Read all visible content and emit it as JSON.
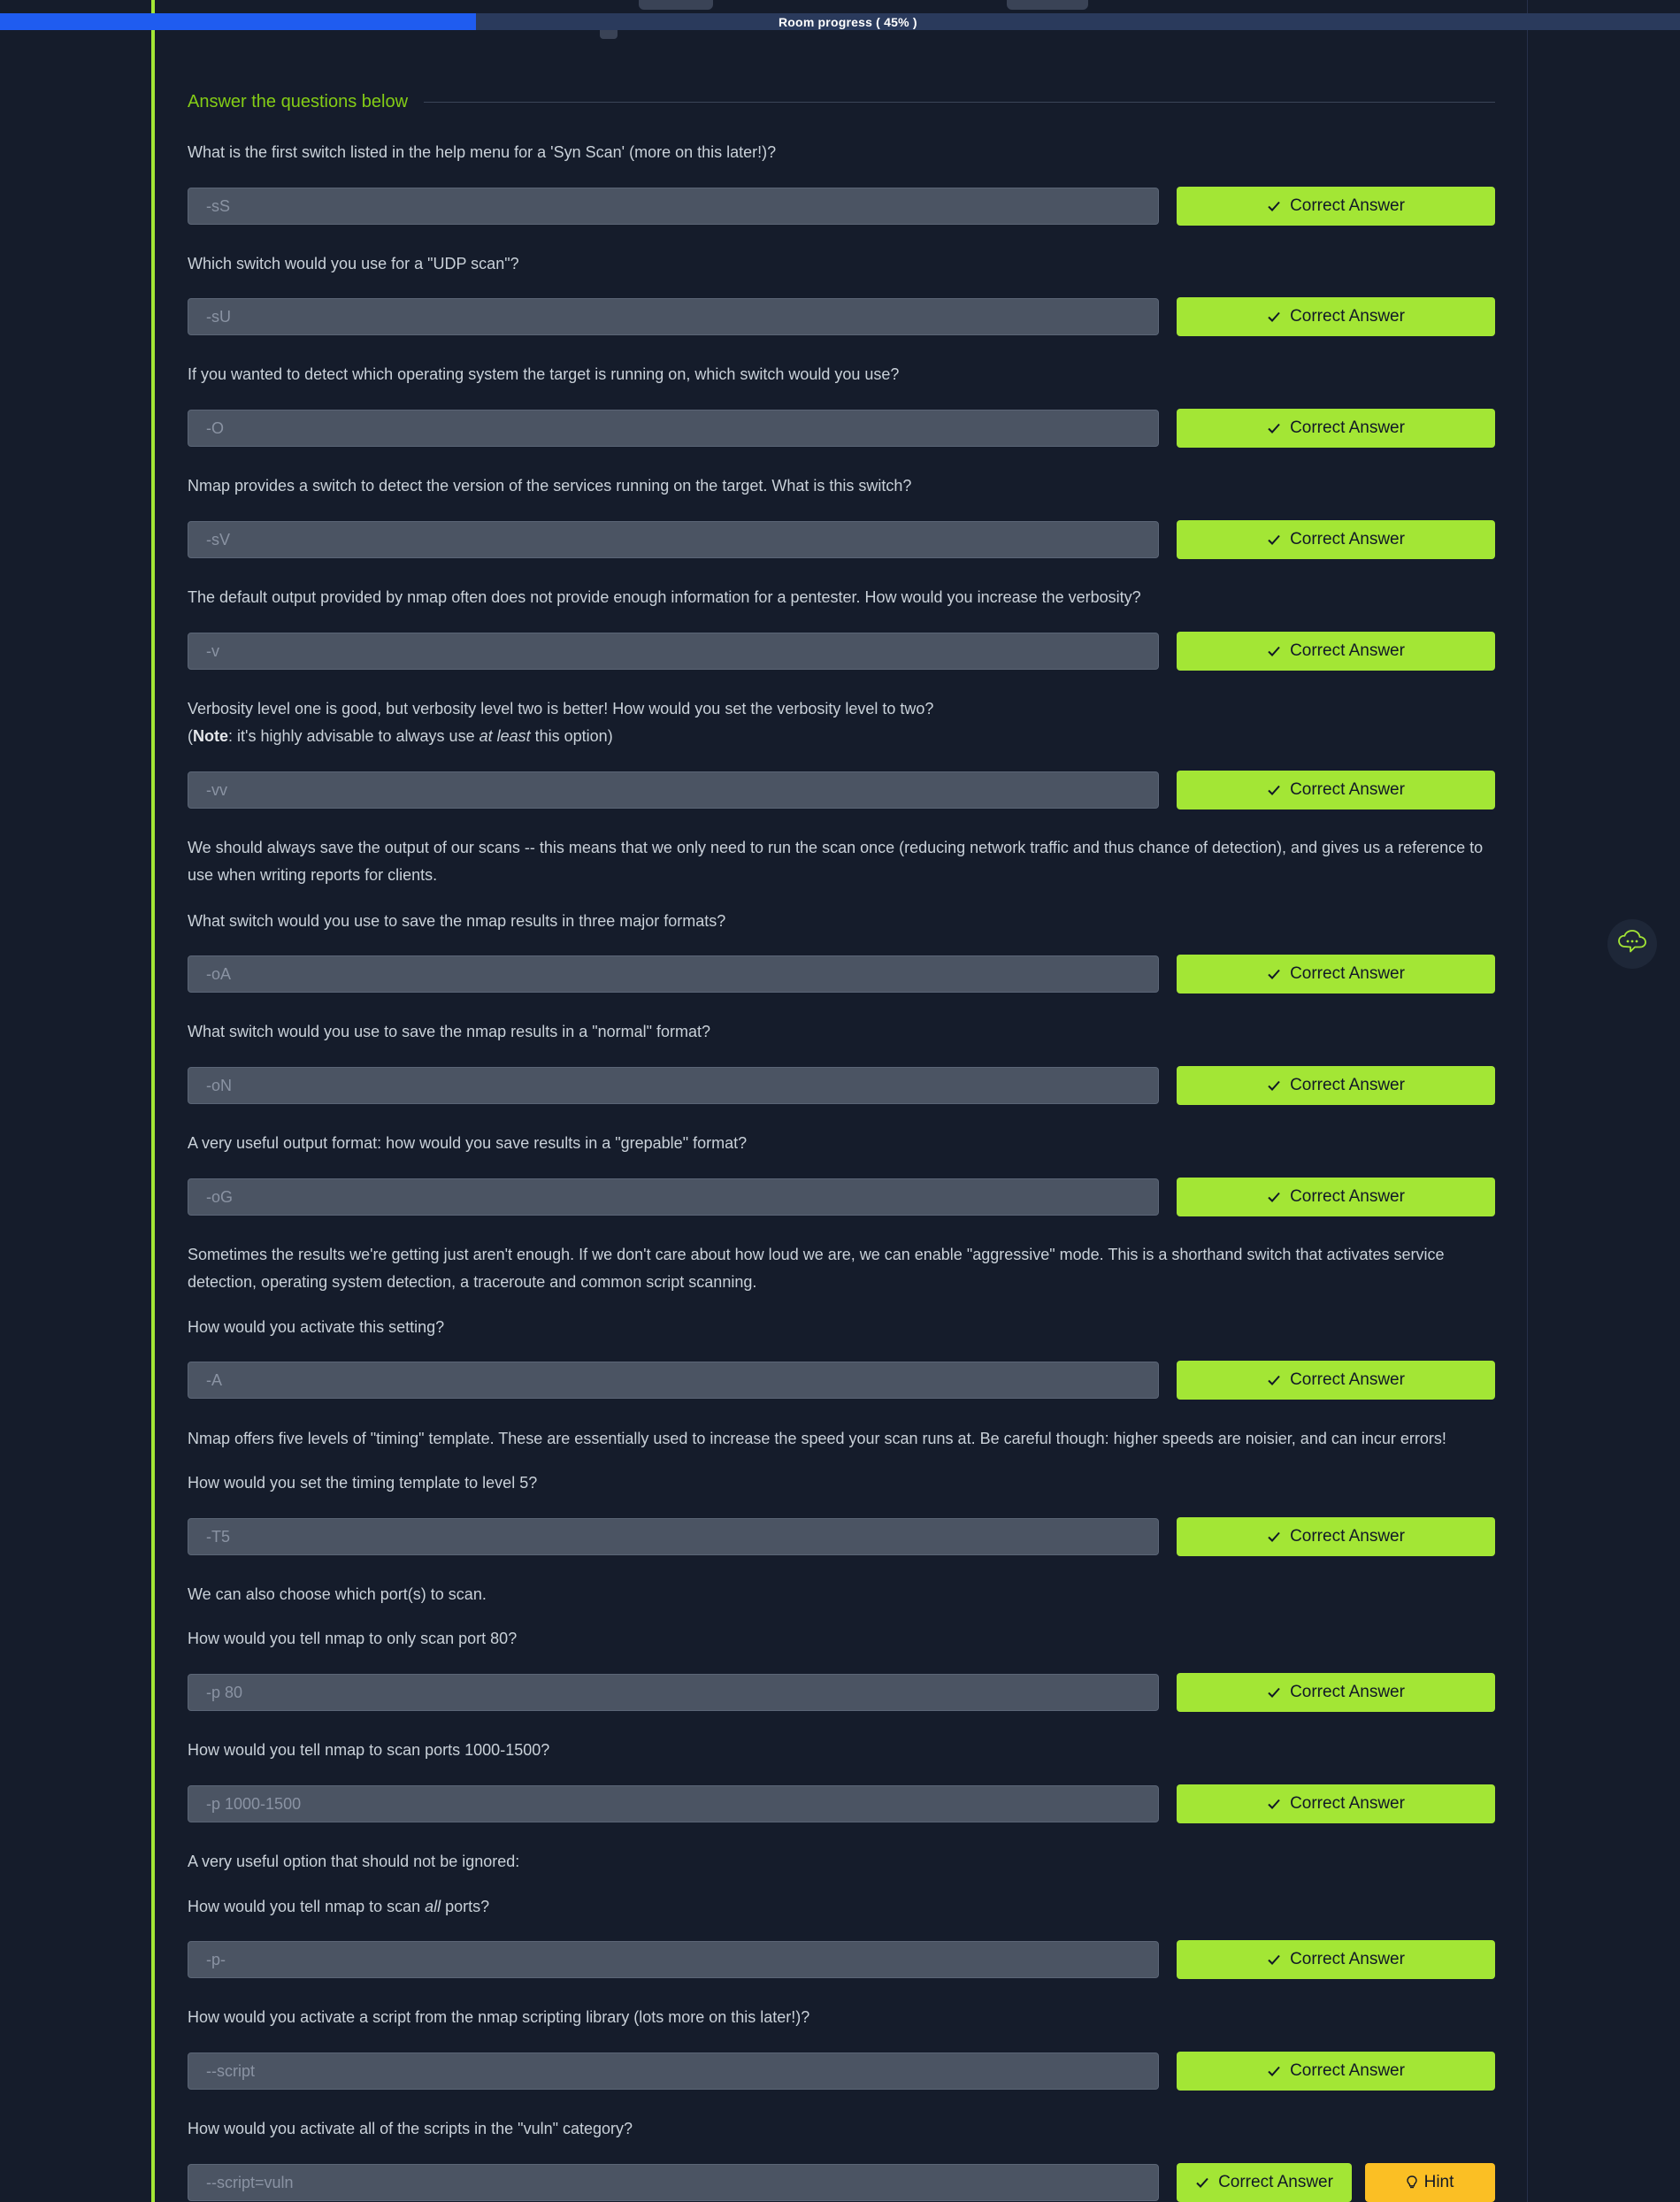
{
  "progress": {
    "label": "Room progress ( 45% )",
    "value": 0.45
  },
  "answer_header": "Answer the questions below",
  "buttons": {
    "correct": "Correct Answer",
    "hint": "Hint"
  },
  "colors": {
    "accent": "#a3e635",
    "hint": "#fbbf24",
    "progress": "#1f5cf0",
    "background": "#151c2b"
  },
  "icons": {
    "check": "check-icon",
    "hint": "lightbulb-icon",
    "chat": "chat-bot-icon"
  },
  "questions": [
    {
      "text": "What is the first switch listed in the help menu for a 'Syn Scan' (more on this later!)?",
      "answer": "-sS"
    },
    {
      "text": "Which switch would you use for a \"UDP scan\"?",
      "answer": "-sU"
    },
    {
      "text": "If you wanted to detect which operating system the target is running on, which switch would you use?",
      "answer": "-O"
    },
    {
      "text": "Nmap provides a switch to detect the version of the services running on the target. What is this switch?",
      "answer": "-sV"
    },
    {
      "text": "The default output provided by nmap often does not provide enough information for a pentester. How would you increase the verbosity?",
      "answer": "-v"
    },
    {
      "text": "Verbosity level one is good, but verbosity level two is better! How would you set the verbosity level to two?",
      "note_open": "(",
      "note_label": "Note",
      "note_mid": ": it's highly advisable to always use ",
      "note_em": "at least",
      "note_end": " this option)",
      "answer": "-vv"
    },
    {
      "intro": "We should always save the output of our scans -- this means that we only need to run the scan once (reducing network traffic and thus chance of detection), and gives us a reference to use when writing reports for clients.",
      "text": "What switch would you use to save the nmap results in three major formats?",
      "answer": "-oA"
    },
    {
      "text": "What switch would you use to save the nmap results in a \"normal\" format?",
      "answer": "-oN"
    },
    {
      "text": "A very useful output format: how would you save results in a \"grepable\" format?",
      "answer": "-oG"
    },
    {
      "intro": "Sometimes the results we're getting just aren't enough. If we don't care about how loud we are, we can enable \"aggressive\" mode. This is a shorthand switch that activates service detection, operating system detection, a traceroute and common script scanning.",
      "text": "How would you activate this setting?",
      "answer": "-A"
    },
    {
      "intro": "Nmap offers five levels of \"timing\" template. These are essentially used to increase the speed your scan runs at. Be careful though: higher speeds are noisier, and can incur errors!",
      "text": "How would you set the timing template to level 5?",
      "answer": "-T5"
    },
    {
      "intro": "We can also choose which port(s) to scan.",
      "text": "How would you tell nmap to only scan port 80?",
      "answer": "-p 80"
    },
    {
      "text": "How would you tell nmap to scan ports 1000-1500?",
      "answer": "-p 1000-1500"
    },
    {
      "intro": "A very useful option that should not be ignored:",
      "text_pre": "How would you tell nmap to scan ",
      "text_em": "all",
      "text_post": " ports?",
      "answer": "-p-"
    },
    {
      "text": "How would you activate a script from the nmap scripting library (lots more on this later!)?",
      "answer": "--script"
    },
    {
      "text": "How would you activate all of the scripts in the \"vuln\" category?",
      "answer": "--script=vuln"
    }
  ]
}
